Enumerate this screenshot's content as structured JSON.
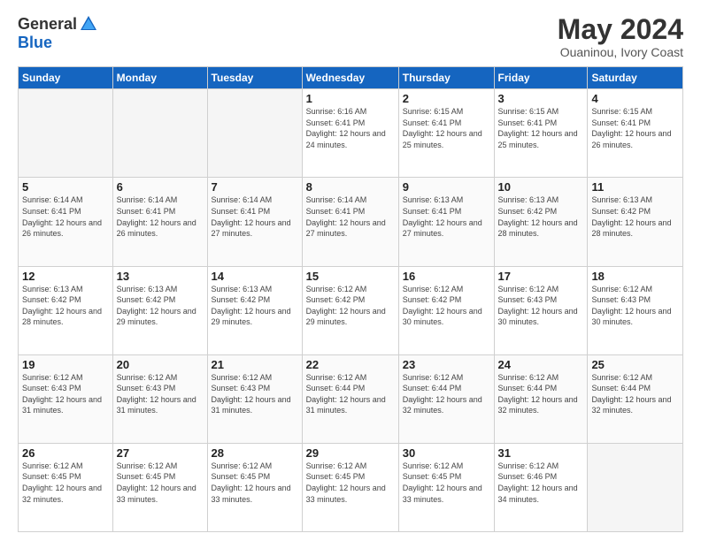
{
  "header": {
    "logo_general": "General",
    "logo_blue": "Blue",
    "month_title": "May 2024",
    "location": "Ouaninou, Ivory Coast"
  },
  "weekdays": [
    "Sunday",
    "Monday",
    "Tuesday",
    "Wednesday",
    "Thursday",
    "Friday",
    "Saturday"
  ],
  "weeks": [
    [
      {
        "day": "",
        "sunrise": "",
        "sunset": "",
        "daylight": ""
      },
      {
        "day": "",
        "sunrise": "",
        "sunset": "",
        "daylight": ""
      },
      {
        "day": "",
        "sunrise": "",
        "sunset": "",
        "daylight": ""
      },
      {
        "day": "1",
        "sunrise": "Sunrise: 6:16 AM",
        "sunset": "Sunset: 6:41 PM",
        "daylight": "Daylight: 12 hours and 24 minutes."
      },
      {
        "day": "2",
        "sunrise": "Sunrise: 6:15 AM",
        "sunset": "Sunset: 6:41 PM",
        "daylight": "Daylight: 12 hours and 25 minutes."
      },
      {
        "day": "3",
        "sunrise": "Sunrise: 6:15 AM",
        "sunset": "Sunset: 6:41 PM",
        "daylight": "Daylight: 12 hours and 25 minutes."
      },
      {
        "day": "4",
        "sunrise": "Sunrise: 6:15 AM",
        "sunset": "Sunset: 6:41 PM",
        "daylight": "Daylight: 12 hours and 26 minutes."
      }
    ],
    [
      {
        "day": "5",
        "sunrise": "Sunrise: 6:14 AM",
        "sunset": "Sunset: 6:41 PM",
        "daylight": "Daylight: 12 hours and 26 minutes."
      },
      {
        "day": "6",
        "sunrise": "Sunrise: 6:14 AM",
        "sunset": "Sunset: 6:41 PM",
        "daylight": "Daylight: 12 hours and 26 minutes."
      },
      {
        "day": "7",
        "sunrise": "Sunrise: 6:14 AM",
        "sunset": "Sunset: 6:41 PM",
        "daylight": "Daylight: 12 hours and 27 minutes."
      },
      {
        "day": "8",
        "sunrise": "Sunrise: 6:14 AM",
        "sunset": "Sunset: 6:41 PM",
        "daylight": "Daylight: 12 hours and 27 minutes."
      },
      {
        "day": "9",
        "sunrise": "Sunrise: 6:13 AM",
        "sunset": "Sunset: 6:41 PM",
        "daylight": "Daylight: 12 hours and 27 minutes."
      },
      {
        "day": "10",
        "sunrise": "Sunrise: 6:13 AM",
        "sunset": "Sunset: 6:42 PM",
        "daylight": "Daylight: 12 hours and 28 minutes."
      },
      {
        "day": "11",
        "sunrise": "Sunrise: 6:13 AM",
        "sunset": "Sunset: 6:42 PM",
        "daylight": "Daylight: 12 hours and 28 minutes."
      }
    ],
    [
      {
        "day": "12",
        "sunrise": "Sunrise: 6:13 AM",
        "sunset": "Sunset: 6:42 PM",
        "daylight": "Daylight: 12 hours and 28 minutes."
      },
      {
        "day": "13",
        "sunrise": "Sunrise: 6:13 AM",
        "sunset": "Sunset: 6:42 PM",
        "daylight": "Daylight: 12 hours and 29 minutes."
      },
      {
        "day": "14",
        "sunrise": "Sunrise: 6:13 AM",
        "sunset": "Sunset: 6:42 PM",
        "daylight": "Daylight: 12 hours and 29 minutes."
      },
      {
        "day": "15",
        "sunrise": "Sunrise: 6:12 AM",
        "sunset": "Sunset: 6:42 PM",
        "daylight": "Daylight: 12 hours and 29 minutes."
      },
      {
        "day": "16",
        "sunrise": "Sunrise: 6:12 AM",
        "sunset": "Sunset: 6:42 PM",
        "daylight": "Daylight: 12 hours and 30 minutes."
      },
      {
        "day": "17",
        "sunrise": "Sunrise: 6:12 AM",
        "sunset": "Sunset: 6:43 PM",
        "daylight": "Daylight: 12 hours and 30 minutes."
      },
      {
        "day": "18",
        "sunrise": "Sunrise: 6:12 AM",
        "sunset": "Sunset: 6:43 PM",
        "daylight": "Daylight: 12 hours and 30 minutes."
      }
    ],
    [
      {
        "day": "19",
        "sunrise": "Sunrise: 6:12 AM",
        "sunset": "Sunset: 6:43 PM",
        "daylight": "Daylight: 12 hours and 31 minutes."
      },
      {
        "day": "20",
        "sunrise": "Sunrise: 6:12 AM",
        "sunset": "Sunset: 6:43 PM",
        "daylight": "Daylight: 12 hours and 31 minutes."
      },
      {
        "day": "21",
        "sunrise": "Sunrise: 6:12 AM",
        "sunset": "Sunset: 6:43 PM",
        "daylight": "Daylight: 12 hours and 31 minutes."
      },
      {
        "day": "22",
        "sunrise": "Sunrise: 6:12 AM",
        "sunset": "Sunset: 6:44 PM",
        "daylight": "Daylight: 12 hours and 31 minutes."
      },
      {
        "day": "23",
        "sunrise": "Sunrise: 6:12 AM",
        "sunset": "Sunset: 6:44 PM",
        "daylight": "Daylight: 12 hours and 32 minutes."
      },
      {
        "day": "24",
        "sunrise": "Sunrise: 6:12 AM",
        "sunset": "Sunset: 6:44 PM",
        "daylight": "Daylight: 12 hours and 32 minutes."
      },
      {
        "day": "25",
        "sunrise": "Sunrise: 6:12 AM",
        "sunset": "Sunset: 6:44 PM",
        "daylight": "Daylight: 12 hours and 32 minutes."
      }
    ],
    [
      {
        "day": "26",
        "sunrise": "Sunrise: 6:12 AM",
        "sunset": "Sunset: 6:45 PM",
        "daylight": "Daylight: 12 hours and 32 minutes."
      },
      {
        "day": "27",
        "sunrise": "Sunrise: 6:12 AM",
        "sunset": "Sunset: 6:45 PM",
        "daylight": "Daylight: 12 hours and 33 minutes."
      },
      {
        "day": "28",
        "sunrise": "Sunrise: 6:12 AM",
        "sunset": "Sunset: 6:45 PM",
        "daylight": "Daylight: 12 hours and 33 minutes."
      },
      {
        "day": "29",
        "sunrise": "Sunrise: 6:12 AM",
        "sunset": "Sunset: 6:45 PM",
        "daylight": "Daylight: 12 hours and 33 minutes."
      },
      {
        "day": "30",
        "sunrise": "Sunrise: 6:12 AM",
        "sunset": "Sunset: 6:45 PM",
        "daylight": "Daylight: 12 hours and 33 minutes."
      },
      {
        "day": "31",
        "sunrise": "Sunrise: 6:12 AM",
        "sunset": "Sunset: 6:46 PM",
        "daylight": "Daylight: 12 hours and 34 minutes."
      },
      {
        "day": "",
        "sunrise": "",
        "sunset": "",
        "daylight": ""
      }
    ]
  ]
}
